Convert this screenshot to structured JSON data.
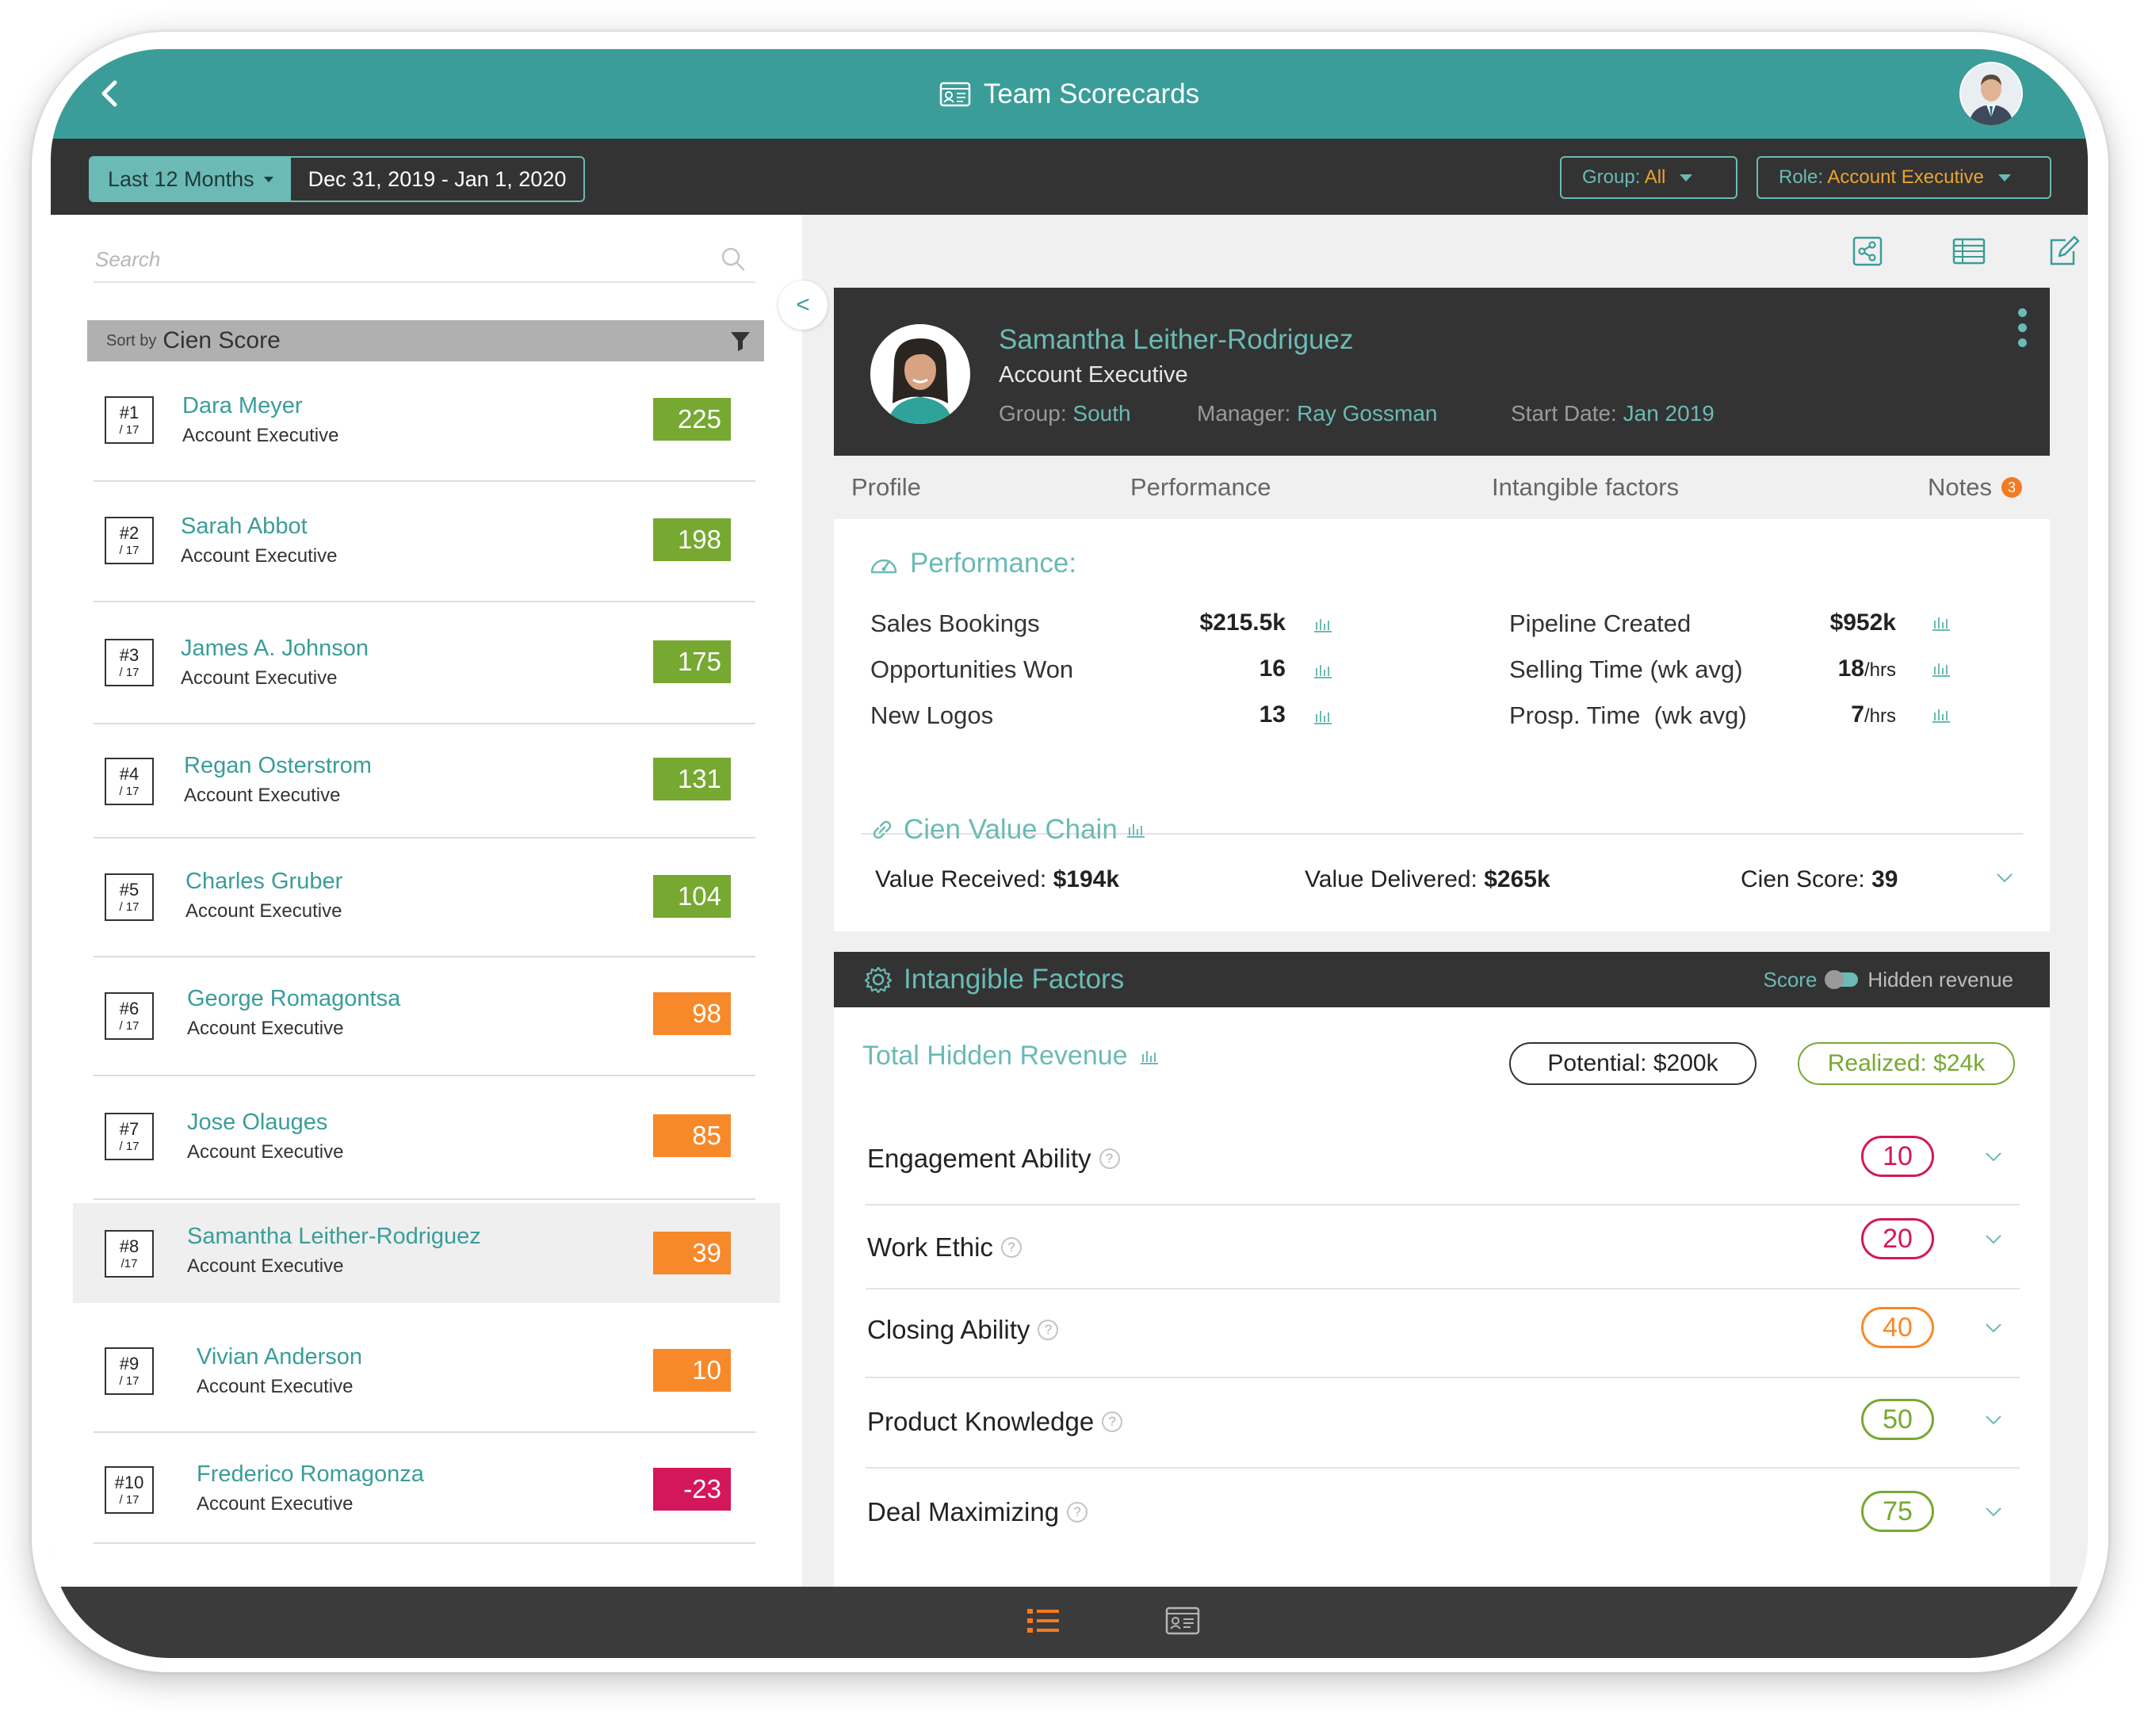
{
  "header": {
    "title": "Team Scorecards"
  },
  "filters": {
    "period_label": "Last 12 Months",
    "date_range": "Dec 31, 2019 - Jan 1, 2020",
    "group_label": "Group:",
    "group_value": "All",
    "role_label": "Role:",
    "role_value": "Account Executive"
  },
  "sidebar": {
    "search_placeholder": "Search",
    "sort_prefix": "Sort by",
    "sort_value": "Cien Score",
    "collapse_label": "<",
    "reps": [
      {
        "rank": "#1",
        "total": "/ 17",
        "name": "Dara Meyer",
        "role": "Account Executive",
        "score": "225",
        "color": "#77a832"
      },
      {
        "rank": "#2",
        "total": "/ 17",
        "name": "Sarah Abbot",
        "role": "Account Executive",
        "score": "198",
        "color": "#77a832"
      },
      {
        "rank": "#3",
        "total": "/ 17",
        "name": "James A. Johnson",
        "role": "Account Executive",
        "score": "175",
        "color": "#77a832"
      },
      {
        "rank": "#4",
        "total": "/ 17",
        "name": "Regan Osterstrom",
        "role": "Account Executive",
        "score": "131",
        "color": "#77a832"
      },
      {
        "rank": "#5",
        "total": "/ 17",
        "name": "Charles Gruber",
        "role": "Account Executive",
        "score": "104",
        "color": "#77a832"
      },
      {
        "rank": "#6",
        "total": "/ 17",
        "name": "George Romagontsa",
        "role": "Account Executive",
        "score": "98",
        "color": "#f7892a"
      },
      {
        "rank": "#7",
        "total": "/ 17",
        "name": "Jose Olauges",
        "role": "Account Executive",
        "score": "85",
        "color": "#f7892a"
      },
      {
        "rank": "#8",
        "total": "/17",
        "name": "Samantha Leither-Rodriguez",
        "role": "Account Executive",
        "score": "39",
        "color": "#f7892a"
      },
      {
        "rank": "#9",
        "total": "/ 17",
        "name": "Vivian Anderson",
        "role": "Account Executive",
        "score": "10",
        "color": "#f7892a"
      },
      {
        "rank": "#10",
        "total": "/ 17",
        "name": "Frederico Romagonza",
        "role": "Account Executive",
        "score": "-23",
        "color": "#d4175a"
      }
    ]
  },
  "profile": {
    "name": "Samantha Leither-Rodriguez",
    "title": "Account Executive",
    "group_label": "Group:",
    "group_value": "South",
    "manager_label": "Manager:",
    "manager_value": "Ray Gossman",
    "start_label": "Start Date:",
    "start_value": "Jan 2019"
  },
  "tabs": {
    "profile": "Profile",
    "performance": "Performance",
    "intangible": "Intangible factors",
    "notes": "Notes",
    "notes_count": "3"
  },
  "performance": {
    "heading": "Performance:",
    "metrics": [
      {
        "label": "Sales Bookings",
        "value": "$215.5k",
        "unit": ""
      },
      {
        "label": "Opportunities Won",
        "value": "16",
        "unit": ""
      },
      {
        "label": "New Logos",
        "value": "13",
        "unit": ""
      },
      {
        "label": "Pipeline Created",
        "value": "$952k",
        "unit": ""
      },
      {
        "label": "Selling Time (wk avg)",
        "value": "18",
        "unit": "/hrs"
      },
      {
        "label": "Prosp. Time  (wk avg)",
        "value": "7",
        "unit": "/hrs"
      }
    ]
  },
  "value_chain": {
    "heading": "Cien Value Chain",
    "received_label": "Value Received:",
    "received_value": "$194k",
    "delivered_label": "Value Delivered:",
    "delivered_value": "$265k",
    "score_label": "Cien Score:",
    "score_value": "39"
  },
  "intangible": {
    "heading": "Intangible Factors",
    "toggle_left": "Score",
    "toggle_right": "Hidden revenue",
    "total_label": "Total Hidden Revenue",
    "potential": "Potential: $200k",
    "realized": "Realized: $24k",
    "factors": [
      {
        "label": "Engagement Ability",
        "score": "10",
        "color": "#d4175a"
      },
      {
        "label": "Work Ethic",
        "score": "20",
        "color": "#d4175a"
      },
      {
        "label": "Closing Ability",
        "score": "40",
        "color": "#f7892a"
      },
      {
        "label": "Product Knowledge",
        "score": "50",
        "color": "#77a832"
      },
      {
        "label": "Deal Maximizing",
        "score": "75",
        "color": "#77a832"
      }
    ]
  },
  "colors": {
    "teal": "#3a9d99",
    "teal_light": "#6bbab5",
    "dark": "#333333",
    "orange": "#f47b20",
    "green": "#77a832",
    "red": "#d4175a"
  },
  "icons": [
    "back-icon",
    "id-card-icon",
    "search-icon",
    "filter-icon",
    "share-icon",
    "table-icon",
    "edit-icon",
    "gauge-icon",
    "bar-chart-icon",
    "link-icon",
    "gear-icon",
    "help-icon",
    "chevron-down-icon",
    "list-icon"
  ]
}
